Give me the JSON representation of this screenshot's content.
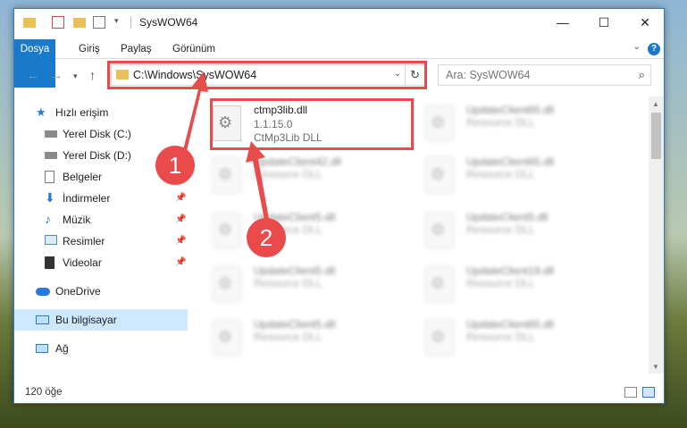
{
  "window": {
    "title": "SysWOW64"
  },
  "ribbon": {
    "tabs": [
      "Dosya",
      "Giriş",
      "Paylaş",
      "Görünüm"
    ]
  },
  "address": {
    "path": "C:\\Windows\\SysWOW64"
  },
  "search": {
    "placeholder": "Ara: SysWOW64"
  },
  "sidebar": {
    "items": [
      {
        "label": "Hızlı erişim",
        "icon": "star-icon"
      },
      {
        "label": "Yerel Disk (C:)",
        "icon": "drive-icon"
      },
      {
        "label": "Yerel Disk (D:)",
        "icon": "drive-icon"
      },
      {
        "label": "Belgeler",
        "icon": "documents-icon"
      },
      {
        "label": "İndirmeler",
        "icon": "download-icon"
      },
      {
        "label": "Müzik",
        "icon": "music-icon"
      },
      {
        "label": "Resimler",
        "icon": "pictures-icon"
      },
      {
        "label": "Videolar",
        "icon": "video-icon"
      },
      {
        "label": "OneDrive",
        "icon": "cloud-icon"
      },
      {
        "label": "Bu bilgisayar",
        "icon": "computer-icon"
      },
      {
        "label": "Ağ",
        "icon": "network-icon"
      }
    ]
  },
  "files": [
    {
      "name": "ctmp3lib.dll",
      "version": "1.1.15.0",
      "description": "CtMp3Lib DLL"
    },
    {
      "name": "UpdateClient65.dll",
      "description": "Resource DLL"
    },
    {
      "name": "UpdateClient42.dll",
      "description": "Resource DLL"
    },
    {
      "name": "UpdateClient65.dll",
      "description": "Resource DLL"
    },
    {
      "name": "UpdateClient5.dll",
      "description": "Resource DLL"
    },
    {
      "name": "UpdateClient5.dll",
      "description": "Resource DLL"
    },
    {
      "name": "UpdateClient5.dll",
      "description": "Resource DLL"
    },
    {
      "name": "UpdateClient19.dll",
      "description": "Resource DLL"
    },
    {
      "name": "UpdateClient5.dll",
      "description": "Resource DLL"
    },
    {
      "name": "UpdateClient65.dll",
      "description": "Resource DLL"
    }
  ],
  "status": {
    "item_count": "120 öğe"
  },
  "annotations": {
    "step1": "1",
    "step2": "2"
  },
  "colors": {
    "accent": "#1979ca",
    "highlight": "#e94b4b",
    "selection": "#cde8ff"
  }
}
